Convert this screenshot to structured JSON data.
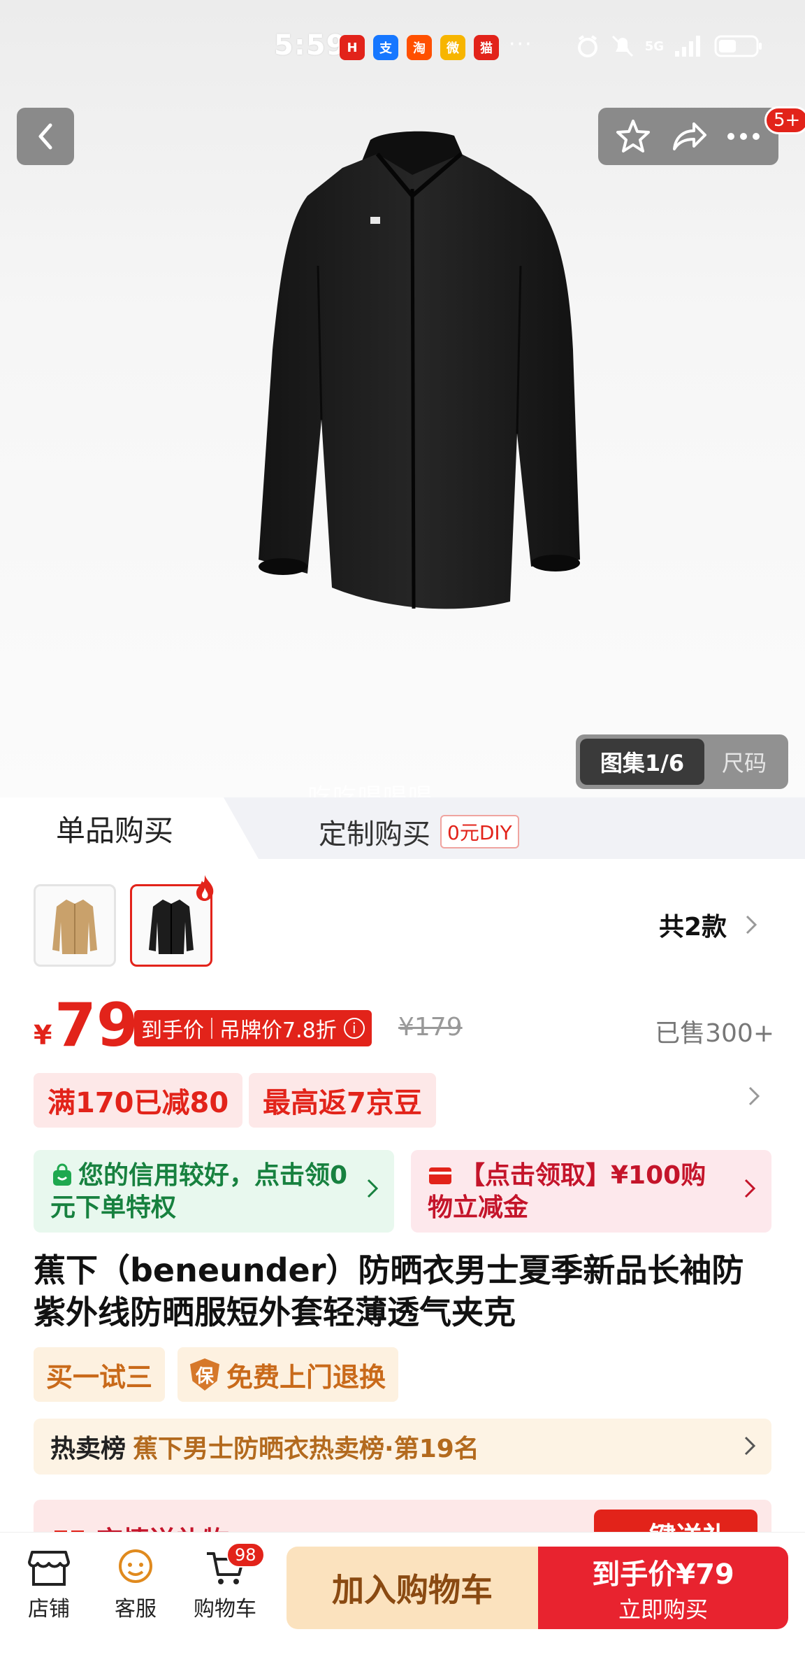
{
  "status_bar": {
    "time": "5:59",
    "apps": [
      {
        "name": "huawei-app-icon",
        "glyph": "H",
        "color": "#e2231a"
      },
      {
        "name": "alipay-app-icon",
        "glyph": "支",
        "color": "#1677ff"
      },
      {
        "name": "taobao-app-icon",
        "glyph": "淘",
        "color": "#ff5000"
      },
      {
        "name": "weibo-app-icon",
        "glyph": "微",
        "color": "#f7b500"
      },
      {
        "name": "tmall-app-icon",
        "glyph": "猫",
        "color": "#e2231a"
      }
    ],
    "more": "···",
    "network": "5G"
  },
  "header": {
    "notification_badge": "5+"
  },
  "gallery": {
    "active_label": "图集1/6",
    "other_label": "尺码",
    "watermark": "吃吃喝喝喝"
  },
  "purchase_tabs": {
    "single": "单品购买",
    "custom": "定制购买",
    "custom_tag": "0元DIY"
  },
  "variants": {
    "total_label": "共2款",
    "colors": [
      "#c9a16b",
      "#1c1c1c"
    ]
  },
  "price": {
    "currency": "¥",
    "value": "79",
    "tag_left": "到手价",
    "tag_right": "吊牌价7.8折",
    "original": "¥179",
    "sold": "已售300+"
  },
  "promotions": [
    "满170已减80",
    "最高返7京豆"
  ],
  "benefits": {
    "credit": "您的信用较好，点击领0元下单特权",
    "coupon": "【点击领取】¥100购物立减金"
  },
  "product": {
    "title": "蕉下（beneunder）防晒衣男士夏季新品长袖防紫外线防晒服短外套轻薄透气夹克"
  },
  "service_tags": {
    "trial": "买一试三",
    "return_icon_char": "保",
    "return": "免费上门退换"
  },
  "ranking": {
    "label": "热卖榜",
    "text": "蕉下男士防晒衣热卖榜·第19名"
  },
  "gift": {
    "label": "京情送礼物",
    "button": "一键送礼"
  },
  "bottom_bar": {
    "store": "店铺",
    "service": "客服",
    "cart": "购物车",
    "cart_count": "98",
    "add_to_cart": "加入购物车",
    "buy_price": "到手价¥79",
    "buy_now": "立即购买"
  },
  "colors": {
    "accent_red": "#e2231a",
    "cart_button_bg": "#fbe2be",
    "green_text": "#17813f"
  }
}
